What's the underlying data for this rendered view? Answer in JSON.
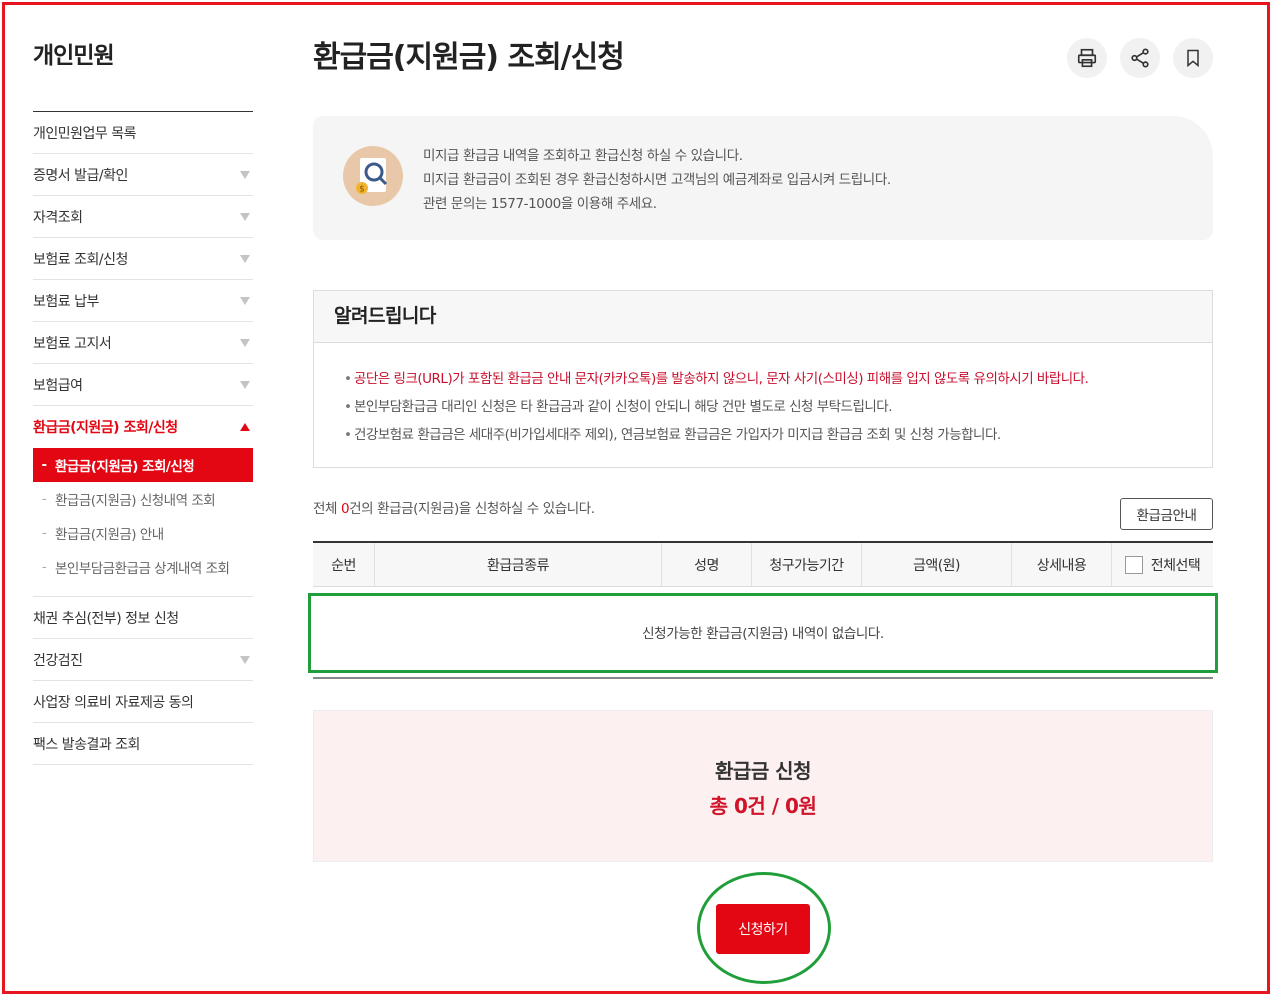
{
  "sidebar": {
    "title": "개인민원",
    "items": [
      {
        "label": "개인민원업무 목록",
        "has_arrow": false
      },
      {
        "label": "증명서 발급/확인",
        "has_arrow": true
      },
      {
        "label": "자격조회",
        "has_arrow": true
      },
      {
        "label": "보험료 조회/신청",
        "has_arrow": true
      },
      {
        "label": "보험료 납부",
        "has_arrow": true
      },
      {
        "label": "보험료 고지서",
        "has_arrow": true
      },
      {
        "label": "보험급여",
        "has_arrow": true
      },
      {
        "label": "환급금(지원금) 조회/신청",
        "has_arrow": true,
        "active": true
      }
    ],
    "subitems": [
      {
        "label": "환급금(지원금) 조회/신청",
        "active": true
      },
      {
        "label": "환급금(지원금) 신청내역 조회"
      },
      {
        "label": "환급금(지원금) 안내"
      },
      {
        "label": "본인부담금환급금 상계내역 조회"
      }
    ],
    "items_after": [
      {
        "label": "채권 추심(전부) 정보 신청",
        "has_arrow": false
      },
      {
        "label": "건강검진",
        "has_arrow": true
      },
      {
        "label": "사업장 의료비 자료제공 동의",
        "has_arrow": false
      },
      {
        "label": "팩스 발송결과 조회",
        "has_arrow": false
      }
    ]
  },
  "page": {
    "title": "환급금(지원금) 조회/신청",
    "tools": [
      "print-icon",
      "share-icon",
      "bookmark-icon"
    ]
  },
  "intro": {
    "icon": "search-document-icon",
    "lines": [
      "미지급 환급금 내역을 조회하고 환급신청 하실 수 있습니다.",
      "미지급 환급금이 조회된 경우 환급신청하시면 고객님의 예금계좌로 입금시켜 드립니다.",
      "관련 문의는 1577-1000을 이용해 주세요."
    ]
  },
  "notice": {
    "title": "알려드립니다",
    "items": [
      {
        "text": "공단은 링크(URL)가 포함된 환급금 안내 문자(카카오톡)를 발송하지 않으니, 문자 사기(스미싱) 피해를 입지 않도록 유의하시기 바랍니다.",
        "highlight": true
      },
      {
        "text": "본인부담환급금 대리인 신청은 타 환급금과 같이 신청이 안되니 해당 건만 별도로 신청 부탁드립니다.",
        "highlight": false
      },
      {
        "text": "건강보험료 환급금은 세대주(비가입세대주 제외), 연금보험료 환급금은 가입자가 미지급 환급금 조회 및 신청 가능합니다.",
        "highlight": false
      }
    ]
  },
  "count": {
    "prefix": "전체 ",
    "number": "0",
    "suffix": "건의 환급금(지원금)을 신청하실 수 있습니다.",
    "guide_button": "환급금안내"
  },
  "table": {
    "headers": [
      "순번",
      "환급금종류",
      "성명",
      "청구가능기간",
      "금액(원)",
      "상세내용",
      "전체선택"
    ],
    "empty_message": "신청가능한 환급금(지원금) 내역이 없습니다."
  },
  "apply": {
    "title": "환급금 신청",
    "total": "총 0건 / 0원",
    "button": "신청하기"
  },
  "colors": {
    "accent": "#e30613",
    "annotation_red": "#e8141f",
    "annotation_green": "#1f9e3a"
  }
}
